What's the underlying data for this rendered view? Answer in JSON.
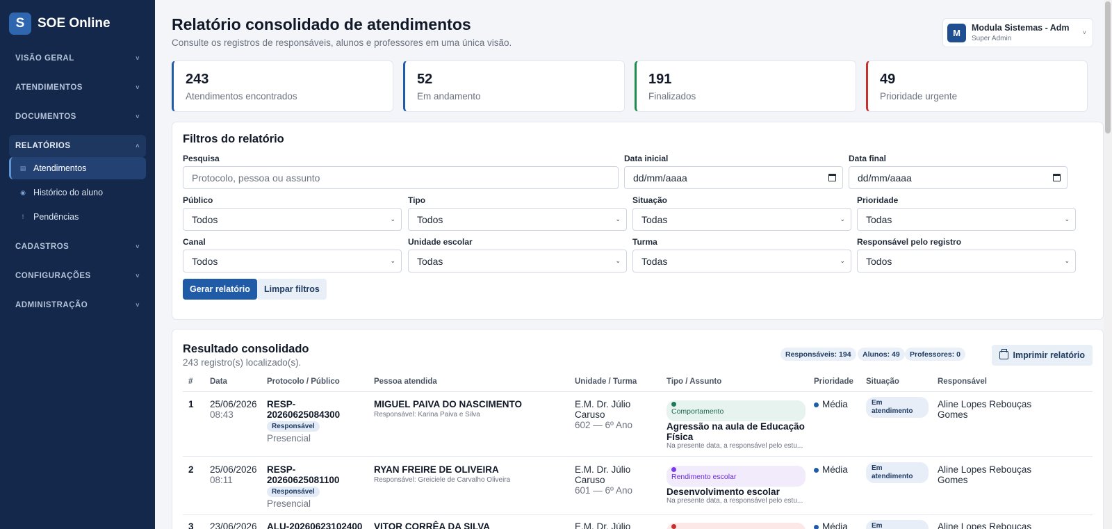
{
  "app": {
    "brand_letter": "S",
    "brand_name": "SOE Online"
  },
  "sidebar": {
    "sections": [
      {
        "label": "VISÃO GERAL",
        "chevron": "˅"
      },
      {
        "label": "ATENDIMENTOS",
        "chevron": "˅"
      },
      {
        "label": "DOCUMENTOS",
        "chevron": "˅"
      },
      {
        "label": "RELATÓRIOS",
        "chevron": "˄"
      },
      {
        "label": "CADASTROS",
        "chevron": "˅"
      },
      {
        "label": "CONFIGURAÇÕES",
        "chevron": "˅"
      },
      {
        "label": "ADMINISTRAÇÃO",
        "chevron": "˅"
      }
    ],
    "report_items": [
      {
        "label": "Atendimentos",
        "icon": "table-icon",
        "active": true
      },
      {
        "label": "Histórico do aluno",
        "icon": "history-icon",
        "active": false
      },
      {
        "label": "Pendências",
        "icon": "alert-icon",
        "active": false
      }
    ]
  },
  "header": {
    "title": "Relatório consolidado de atendimentos",
    "subtitle": "Consulte os registros de responsáveis, alunos e professores em uma única visão.",
    "user": {
      "initial": "M",
      "name": "Modula Sistemas - Adm",
      "role": "Super Admin",
      "chevron": "˅"
    }
  },
  "stats": [
    {
      "value": "243",
      "label": "Atendimentos encontrados",
      "color": "#1f5ba6"
    },
    {
      "value": "52",
      "label": "Em andamento",
      "color": "#1f5ba6"
    },
    {
      "value": "191",
      "label": "Finalizados",
      "color": "#1f8a4c"
    },
    {
      "value": "49",
      "label": "Prioridade urgente",
      "color": "#c53030"
    }
  ],
  "filters": {
    "title": "Filtros do relatório",
    "search": {
      "label": "Pesquisa",
      "placeholder": "Protocolo, pessoa ou assunto"
    },
    "date_start": {
      "label": "Data inicial",
      "value": "dd/mm/aaaa"
    },
    "date_end": {
      "label": "Data final",
      "value": "dd/mm/aaaa"
    },
    "publico": {
      "label": "Público",
      "value": "Todos"
    },
    "tipo": {
      "label": "Tipo",
      "value": "Todos"
    },
    "situacao": {
      "label": "Situação",
      "value": "Todas"
    },
    "prioridade": {
      "label": "Prioridade",
      "value": "Todas"
    },
    "canal": {
      "label": "Canal",
      "value": "Todos"
    },
    "unidade": {
      "label": "Unidade escolar",
      "value": "Todas"
    },
    "turma": {
      "label": "Turma",
      "value": "Todas"
    },
    "responsavel": {
      "label": "Responsável pelo registro",
      "value": "Todos"
    },
    "generate_label": "Gerar relatório",
    "clear_label": "Limpar filtros"
  },
  "results": {
    "title": "Resultado consolidado",
    "subtitle": "243 registro(s) localizado(s).",
    "counts": [
      "Responsáveis: 194",
      "Alunos: 49",
      "Professores: 0"
    ],
    "print_label": "Imprimir relatório",
    "columns": [
      "#",
      "Data",
      "Protocolo / Público",
      "Pessoa atendida",
      "Unidade / Turma",
      "Tipo / Assunto",
      "Prioridade",
      "Situação",
      "Responsável"
    ],
    "rows": [
      {
        "num": "1",
        "date": "25/06/2026",
        "time": "08:43",
        "protocol_1": "RESP-",
        "protocol_2": "20260625084300",
        "public": "Responsável",
        "channel": "Presencial",
        "person": "MIGUEL PAIVA DO NASCIMENTO",
        "person_sub": "Responsável: Karina Paiva e Silva",
        "unit_1": "E.M. Dr. Júlio",
        "unit_2": "Caruso",
        "class": "602 — 6º Ano",
        "category": "Comportamento",
        "category_bg": "#e6f3ef",
        "category_dot": "#1f7a5c",
        "category_color": "#1f6b50",
        "subject_1": "Agressão na aula de Educação",
        "subject_2": "Física",
        "summary": "Na presente data, a responsável pelo estu...",
        "priority": "Média",
        "status_1": "Em",
        "status_2": "atendimento",
        "resp_1": "Aline Lopes Rebouças",
        "resp_2": "Gomes"
      },
      {
        "num": "2",
        "date": "25/06/2026",
        "time": "08:11",
        "protocol_1": "RESP-",
        "protocol_2": "20260625081100",
        "public": "Responsável",
        "channel": "Presencial",
        "person": "RYAN FREIRE DE OLIVEIRA",
        "person_sub": "Responsável: Greiciele de Carvalho Oliveira",
        "unit_1": "E.M. Dr. Júlio",
        "unit_2": "Caruso",
        "class": "601 — 6º Ano",
        "category": "Rendimento escolar",
        "category_bg": "#f1ebfb",
        "category_dot": "#7c3aed",
        "category_color": "#6d28d9",
        "subject_1": "Desenvolvimento escolar",
        "subject_2": "",
        "summary": "Na presente data, a responsável pelo estu...",
        "priority": "Média",
        "status_1": "Em",
        "status_2": "atendimento",
        "resp_1": "Aline Lopes Rebouças",
        "resp_2": "Gomes"
      },
      {
        "num": "3",
        "date": "23/06/2026",
        "time": "",
        "protocol_1": "ALU-20260623102400",
        "protocol_2": "",
        "public": "",
        "channel": "",
        "person": "VITOR CORRÊA DA SILVA",
        "person_sub": "",
        "unit_1": "E.M. Dr. Júlio",
        "unit_2": "",
        "class": "",
        "category": "",
        "category_bg": "#fde8e8",
        "category_dot": "#c53030",
        "category_color": "#c53030",
        "subject_1": "",
        "subject_2": "",
        "summary": "",
        "priority": "Média",
        "status_1": "Em",
        "status_2": "",
        "resp_1": "Aline Lopes Rebouças",
        "resp_2": ""
      }
    ]
  }
}
